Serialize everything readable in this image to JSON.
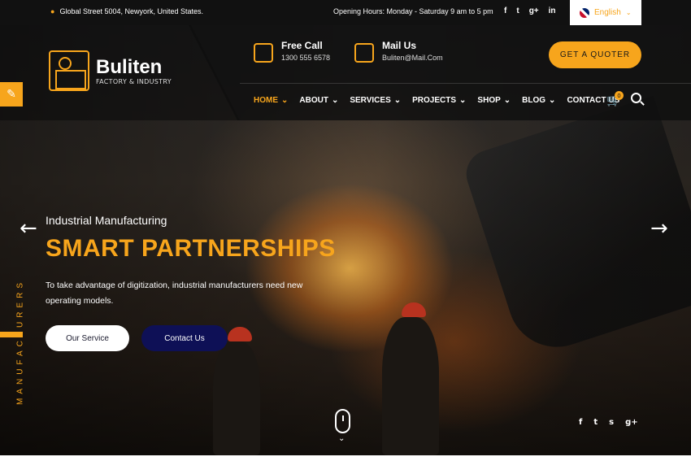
{
  "topbar": {
    "address": "Global Street 5004, Newyork, United States.",
    "hours": "Opening Hours: Monday - Saturday 9 am to 5 pm",
    "socials": [
      {
        "icon": "facebook-icon",
        "glyph": "f"
      },
      {
        "icon": "twitter-icon",
        "glyph": "t"
      },
      {
        "icon": "google-plus-icon",
        "glyph": "g+"
      },
      {
        "icon": "linkedin-icon",
        "glyph": "in"
      }
    ],
    "language": "English"
  },
  "header": {
    "brand": "Buliten",
    "tagline": "FACTORY & INDUSTRY",
    "call_title": "Free Call",
    "call_value": "1300 555 6578",
    "mail_title": "Mail Us",
    "mail_value": "Buliten@Mail.Com",
    "quote_label": "GET A QUOTER"
  },
  "nav": {
    "items": [
      {
        "label": "HOME",
        "active": true,
        "dropdown": true
      },
      {
        "label": "ABOUT",
        "dropdown": true
      },
      {
        "label": "SERVICES",
        "dropdown": true
      },
      {
        "label": "PROJECTS",
        "dropdown": true
      },
      {
        "label": "SHOP",
        "dropdown": true
      },
      {
        "label": "BLOG",
        "dropdown": true
      },
      {
        "label": "CONTACT US",
        "dropdown": false
      }
    ],
    "cart_count": "0"
  },
  "hero": {
    "kicker": "Industrial Manufacturing",
    "headline": "SMART PARTNERSHIPS",
    "description": "To take advantage of digitization, industrial manufacturers need new operating models.",
    "btn_service": "Our Service",
    "btn_contact": "Contact Us",
    "vertical_label": "MANUFACTURERS",
    "socials": [
      {
        "icon": "facebook-icon",
        "glyph": "f"
      },
      {
        "icon": "twitter-icon",
        "glyph": "t"
      },
      {
        "icon": "skype-icon",
        "glyph": "s"
      },
      {
        "icon": "google-plus-icon",
        "glyph": "g+"
      }
    ]
  },
  "colors": {
    "accent": "#f7a51c",
    "navy": "#0e1056"
  }
}
